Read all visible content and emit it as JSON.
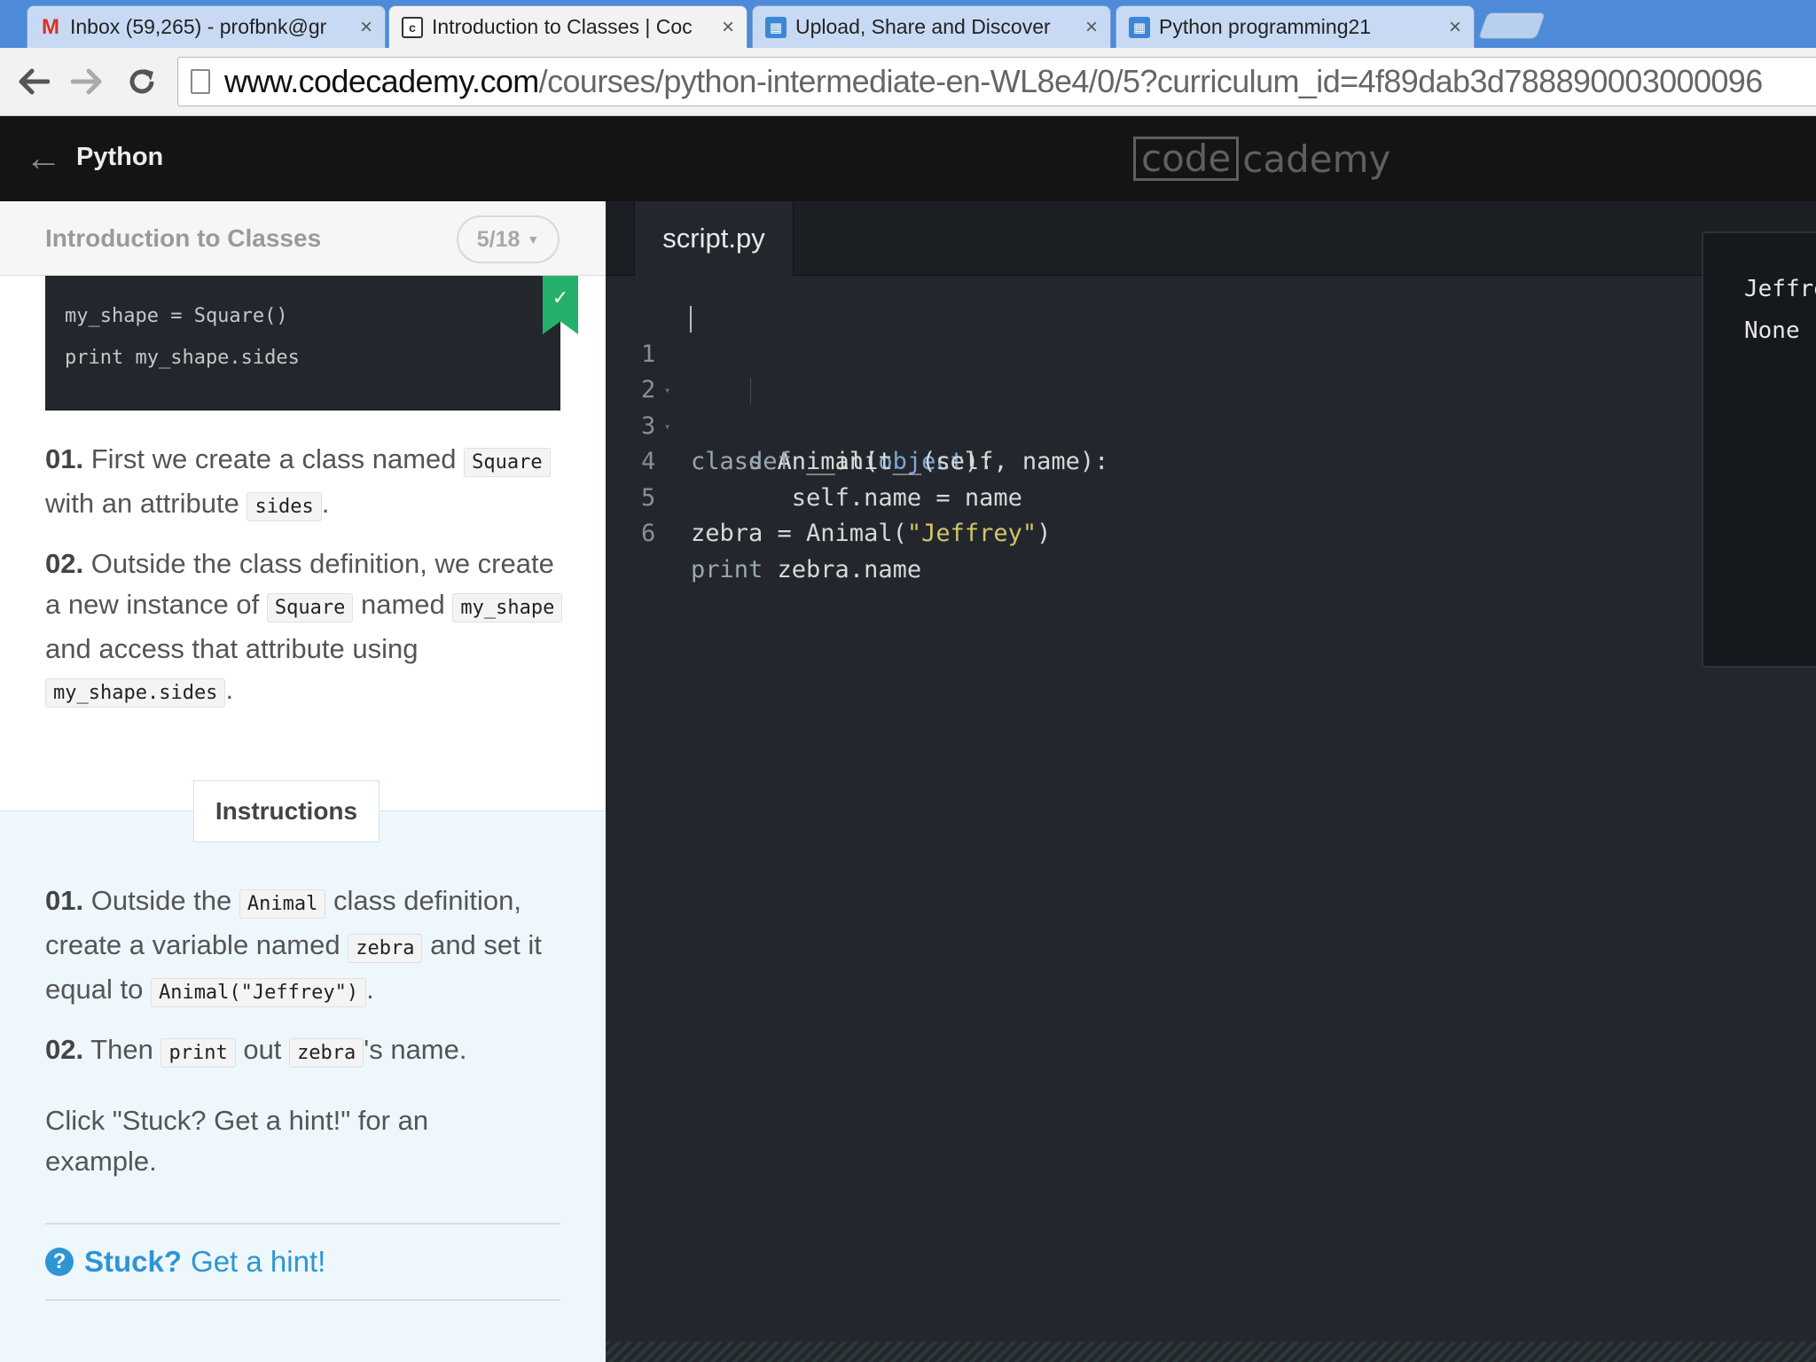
{
  "browser": {
    "tabs": [
      {
        "title": "Inbox (59,265) - profbnk@gr",
        "icon": "gmail-icon",
        "active": false
      },
      {
        "title": "Introduction to Classes | Coc",
        "icon": "codecademy-icon",
        "active": true
      },
      {
        "title": "Upload, Share and Discover",
        "icon": "board-icon",
        "active": false
      },
      {
        "title": "Python programming21",
        "icon": "board-icon",
        "active": false
      }
    ],
    "close_glyph": "×",
    "url_host": "www.codecademy.com",
    "url_path": "/courses/python-intermediate-en-WL8e4/0/5?curriculum_id=4f89dab3d788890003000096"
  },
  "header": {
    "back_glyph": "←",
    "course": "Python",
    "logo_box": "code",
    "logo_rest": "cademy"
  },
  "lesson": {
    "title": "Introduction to Classes",
    "progress": "5/18",
    "example_code": [
      "my_shape = Square()",
      "print my_shape.sides"
    ],
    "step1": {
      "num": "01.",
      "t1": "First we create a class named",
      "c1": "Square",
      "t2": "with an attribute",
      "c2": "sides",
      "t3": "."
    },
    "step2": {
      "num": "02.",
      "t1": "Outside the class definition, we create a new instance of",
      "c1": "Square",
      "t2": "named",
      "c2": "my_shape",
      "t3": "and access that attribute using",
      "c3": "my_shape.sides",
      "t4": "."
    }
  },
  "instructions": {
    "tab_label": "Instructions",
    "step1": {
      "num": "01.",
      "t1": "Outside the",
      "c1": "Animal",
      "t2": "class definition, create a variable named",
      "c2": "zebra",
      "t3": "and set it equal to",
      "c3": "Animal(\"Jeffrey\")",
      "t4": "."
    },
    "step2": {
      "num": "02.",
      "t1": "Then",
      "c1": "print",
      "t2": "out",
      "c2": "zebra",
      "t3": "'s name."
    },
    "note": "Click \"Stuck? Get a hint!\" for an example.",
    "hint_icon": "?",
    "hint_stuck": "Stuck?",
    "hint_link": "Get a hint!"
  },
  "editor": {
    "filename": "script.py",
    "line_numbers": [
      "1",
      "2",
      "3",
      "4",
      "5",
      "6"
    ],
    "fold_glyph": "▾",
    "lines": {
      "l1": {
        "kw": "class",
        "name": " Animal(",
        "bi": "object",
        "end": "):"
      },
      "l2": {
        "indent": "    ",
        "kw": "def",
        "rest": " __init__(self, name):"
      },
      "l3": {
        "indent": "       ",
        "rest": "self.name = name"
      },
      "l5": {
        "pre": "zebra = Animal(",
        "str": "\"Jeffrey\"",
        "end": ")"
      },
      "l6": {
        "kw": "print",
        "rest": " zebra.name"
      }
    }
  },
  "output": {
    "lines": [
      "Jeffrey",
      "None"
    ]
  },
  "colors": {
    "accent": "#2e95d3",
    "bookmark": "#24b06a",
    "editor_bg": "#23272d",
    "string": "#d2c56b"
  }
}
